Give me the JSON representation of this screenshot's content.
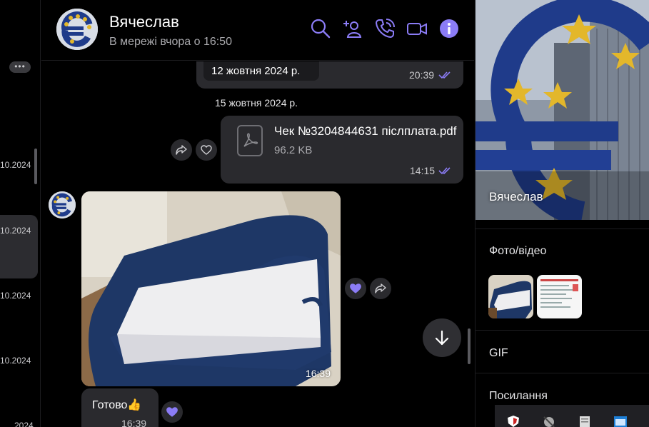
{
  "chat_list": {
    "more_label": "•••",
    "dates": [
      "10.2024",
      "10.2024",
      "10.2024",
      "10.2024",
      "2024"
    ]
  },
  "header": {
    "contact_name": "Вячеслав",
    "status": "В мережі вчора о 16:50",
    "icons": [
      "search-icon",
      "add-contact-icon",
      "phone-call-icon",
      "video-call-icon",
      "info-icon"
    ],
    "accent_color": "#8b7cf6"
  },
  "messages": {
    "prev_date_chip": "12 жовтня 2024 р.",
    "prev_time": "20:39",
    "date_separator": "15 жовтня 2024 р.",
    "file": {
      "name": "Чек №3204844631 післплата.pdf",
      "size": "96.2 KB",
      "time": "14:15"
    },
    "photo_time": "16:39",
    "text_message": {
      "text": "Готово👍",
      "time": "16:39"
    }
  },
  "info_panel": {
    "name": "Вячеслав",
    "media_section": "Фото/відео",
    "gif_section": "GIF",
    "links_section": "Посилання"
  }
}
